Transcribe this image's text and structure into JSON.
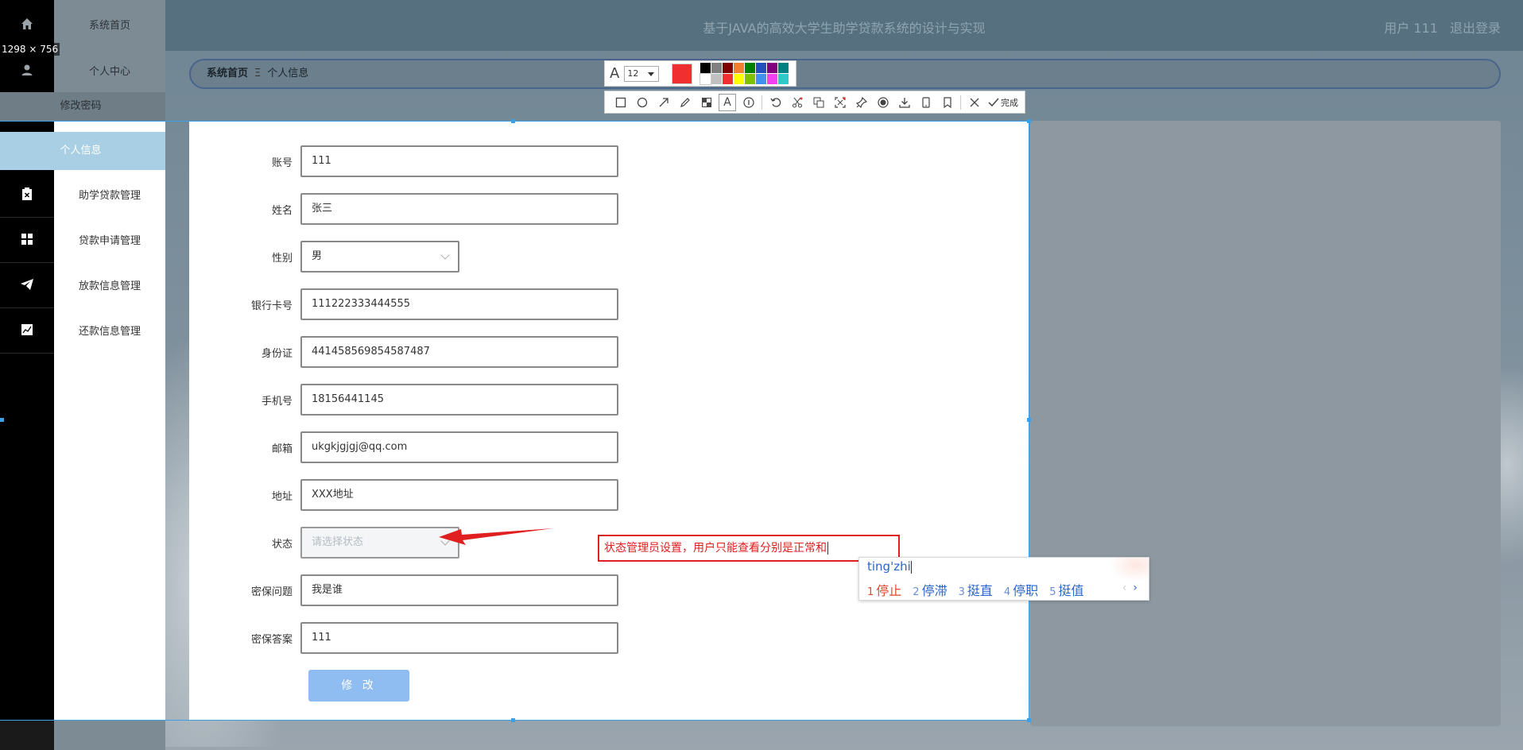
{
  "header": {
    "title": "基于JAVA的高效大学生助学贷款系统的设计与实现",
    "user_label": "用户 111",
    "logout_label": "退出登录"
  },
  "breadcrumb": {
    "home": "系统首页",
    "separator": "Ξ",
    "current": "个人信息"
  },
  "selection_size": "1298 × 756",
  "sidebar": {
    "home": "系统首页",
    "personal_center": "个人中心",
    "change_password": "修改密码",
    "personal_info": "个人信息",
    "loan_mgmt": "助学贷款管理",
    "apply_mgmt": "贷款申请管理",
    "disburse_mgmt": "放款信息管理",
    "repay_mgmt": "还款信息管理"
  },
  "form": {
    "fields": [
      {
        "label": "账号",
        "value": "111"
      },
      {
        "label": "姓名",
        "value": "张三"
      },
      {
        "label": "性别",
        "value": "男"
      },
      {
        "label": "银行卡号",
        "value": "111222333444555"
      },
      {
        "label": "身份证",
        "value": "441458569854587487"
      },
      {
        "label": "手机号",
        "value": "18156441145"
      },
      {
        "label": "邮箱",
        "value": "ukgkjgjgj@qq.com"
      },
      {
        "label": "地址",
        "value": "XXX地址"
      },
      {
        "label": "状态",
        "placeholder": "请选择状态"
      },
      {
        "label": "密保问题",
        "value": "我是谁"
      },
      {
        "label": "密保答案",
        "value": "111"
      }
    ],
    "submit_label": "修 改"
  },
  "toolbar": {
    "font_size": "12",
    "current_color": "#f03030",
    "palette": [
      "#000000",
      "#808080",
      "#800000",
      "#f08030",
      "#008000",
      "#2050c0",
      "#800080",
      "#008080",
      "#ffffff",
      "#c0c0c0",
      "#f03030",
      "#ffff00",
      "#80c000",
      "#4090f0",
      "#f040f0",
      "#30c8c8"
    ],
    "finish_label": "完成"
  },
  "annotation": {
    "text": "状态管理员设置，用户只能查看分别是正常和",
    "color": "#e02020"
  },
  "ime": {
    "pinyin": "ting'zhi",
    "candidates": [
      {
        "num": "1",
        "text": "停止"
      },
      {
        "num": "2",
        "text": "停滞"
      },
      {
        "num": "3",
        "text": "挺直"
      },
      {
        "num": "4",
        "text": "停职"
      },
      {
        "num": "5",
        "text": "挺值"
      }
    ]
  }
}
